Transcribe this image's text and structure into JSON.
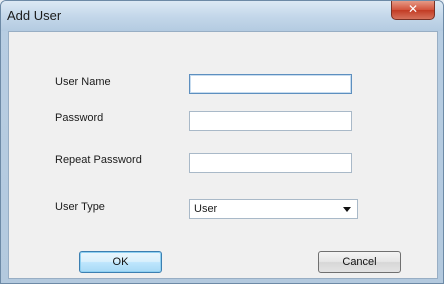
{
  "window": {
    "title": "Add User",
    "close_glyph": "✕"
  },
  "form": {
    "user_name_label": "User Name",
    "user_name_value": "",
    "password_label": "Password",
    "password_value": "",
    "repeat_password_label": "Repeat Password",
    "repeat_password_value": "",
    "user_type_label": "User Type",
    "user_type_selected": "User"
  },
  "buttons": {
    "ok_label": "OK",
    "cancel_label": "Cancel"
  },
  "colors": {
    "close_button": "#d2523b",
    "default_button_border": "#3c7fb1"
  }
}
